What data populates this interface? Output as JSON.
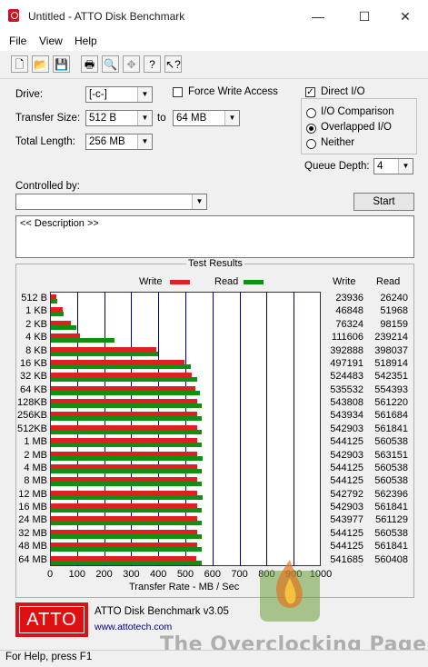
{
  "window": {
    "title": "Untitled - ATTO Disk Benchmark",
    "controls": {
      "minimize": "—",
      "maximize": "☐",
      "close": "✕"
    }
  },
  "menu": [
    "File",
    "View",
    "Help"
  ],
  "toolbar": [
    "new-icon",
    "open-icon",
    "save-icon",
    "print-icon",
    "print-preview-icon",
    "move-icon",
    "help-icon",
    "context-help-icon"
  ],
  "settings": {
    "drive_label": "Drive:",
    "drive_value": "[-c-]",
    "transfer_size_label": "Transfer Size:",
    "transfer_from": "512 B",
    "to_label": "to",
    "transfer_to": "64 MB",
    "total_length_label": "Total Length:",
    "total_length": "256 MB",
    "force_write_access": "Force Write Access",
    "direct_io": "Direct I/O",
    "io_comparison": "I/O Comparison",
    "overlapped_io": "Overlapped I/O",
    "neither": "Neither",
    "queue_depth_label": "Queue Depth:",
    "queue_depth": "4",
    "controlled_by_label": "Controlled by:",
    "controlled_by_value": "",
    "start_button": "Start",
    "description": "<< Description >>"
  },
  "results": {
    "title": "Test Results",
    "write_legend": "Write",
    "read_legend": "Read",
    "write_header": "Write",
    "read_header": "Read",
    "axis_label": "Transfer Rate - MB / Sec"
  },
  "chart_data": {
    "type": "bar",
    "title": "Test Results",
    "xlabel": "Transfer Rate - MB / Sec",
    "xlim": [
      0,
      1000
    ],
    "xticks": [
      0,
      100,
      200,
      300,
      400,
      500,
      600,
      700,
      800,
      900,
      1000
    ],
    "categories": [
      "512 B",
      "1 KB",
      "2 KB",
      "4 KB",
      "8 KB",
      "16 KB",
      "32 KB",
      "64 KB",
      "128KB",
      "256KB",
      "512KB",
      "1 MB",
      "2 MB",
      "4 MB",
      "8 MB",
      "12 MB",
      "16 MB",
      "24 MB",
      "32 MB",
      "48 MB",
      "64 MB"
    ],
    "series": [
      {
        "name": "Write",
        "color": "#e02020",
        "values": [
          23936,
          46848,
          76324,
          111606,
          392888,
          497191,
          524483,
          535532,
          543808,
          543934,
          542903,
          544125,
          542903,
          544125,
          544125,
          542792,
          542903,
          543977,
          544125,
          544125,
          541685
        ]
      },
      {
        "name": "Read",
        "color": "#109010",
        "values": [
          26240,
          51968,
          98159,
          239214,
          398037,
          518914,
          542351,
          554393,
          561220,
          561684,
          561841,
          560538,
          563151,
          560538,
          560538,
          562396,
          561841,
          561129,
          560538,
          561841,
          560408
        ]
      }
    ]
  },
  "footer": {
    "product": "ATTO Disk Benchmark v3.05",
    "url": "www.attotech.com",
    "logo_text": "ATTO"
  },
  "watermark": "The Overclocking Page",
  "status": "For Help, press F1",
  "colors": {
    "write": "#e02020",
    "read": "#109010",
    "brand": "#d11111"
  }
}
